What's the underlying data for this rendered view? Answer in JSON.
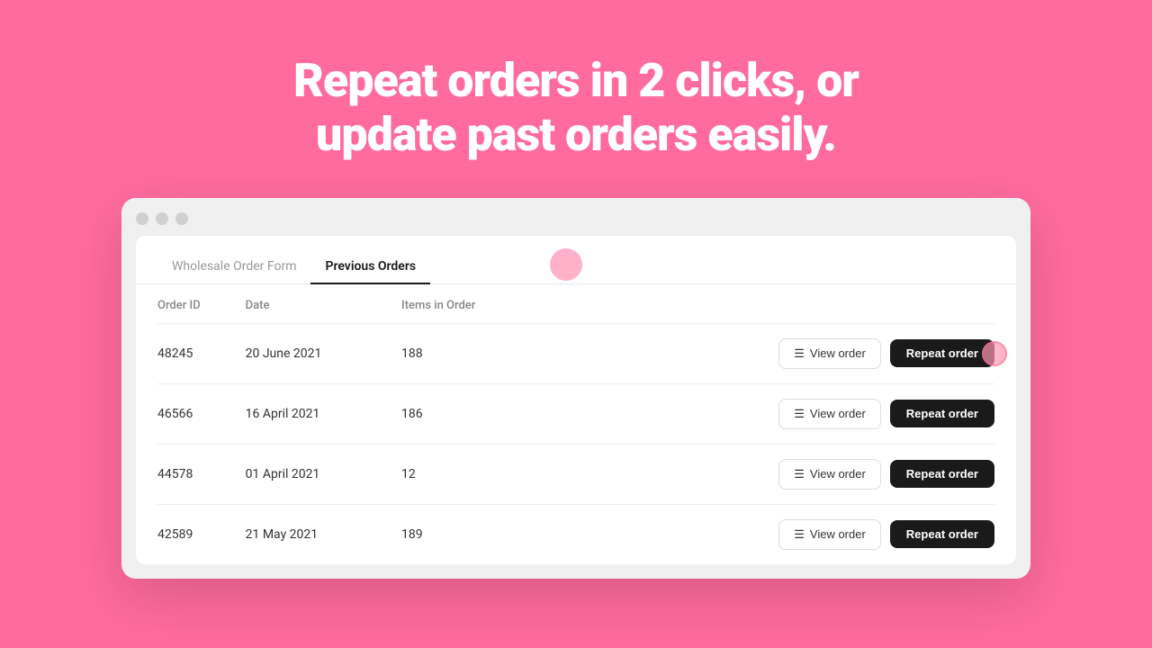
{
  "hero": {
    "line1": "Repeat orders in 2 clicks, or",
    "line2": "update past orders easily."
  },
  "browser": {
    "tabs": [
      {
        "id": "wholesale",
        "label": "Wholesale Order Form",
        "active": false
      },
      {
        "id": "previous",
        "label": "Previous Orders",
        "active": true
      }
    ],
    "table": {
      "columns": [
        {
          "id": "order_id",
          "label": "Order ID"
        },
        {
          "id": "date",
          "label": "Date"
        },
        {
          "id": "items",
          "label": "Items in Order"
        },
        {
          "id": "actions",
          "label": ""
        }
      ],
      "rows": [
        {
          "order_id": "48245",
          "date": "20 June 2021",
          "items": "188",
          "is_first": true
        },
        {
          "order_id": "46566",
          "date": "16 April 2021",
          "items": "186",
          "is_first": false
        },
        {
          "order_id": "44578",
          "date": "01 April 2021",
          "items": "12",
          "is_first": false
        },
        {
          "order_id": "42589",
          "date": "21 May 2021",
          "items": "189",
          "is_first": false
        }
      ]
    },
    "buttons": {
      "view_order": "View order",
      "repeat_order": "Repeat order"
    }
  }
}
